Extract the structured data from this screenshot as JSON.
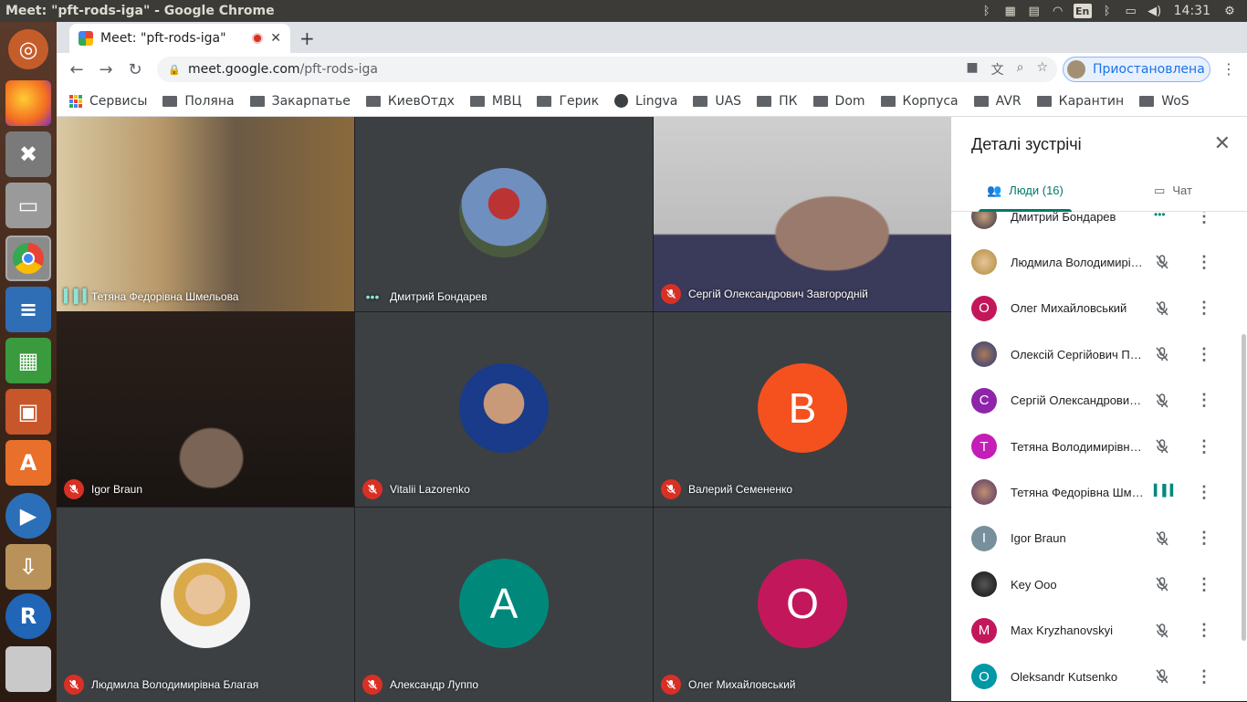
{
  "window": {
    "title": "Meet: \"pft-rods-iga\" - Google Chrome"
  },
  "topbar": {
    "lang": "En",
    "time": "14:31"
  },
  "tab": {
    "title": "Meet: \"pft-rods-iga\"",
    "close": "✕",
    "new": "+"
  },
  "omnibox": {
    "host": "meet.google.com",
    "path": "/pft-rods-iga"
  },
  "profile": {
    "label": "Приостановлена"
  },
  "bookmarks": [
    "Сервисы",
    "Поляна",
    "Закарпатье",
    "КиевОтдх",
    "МВЦ",
    "Герик",
    "Lingva",
    "UAS",
    "ПК",
    "Dom",
    "Корпуса",
    "AVR",
    "Карантин",
    "WoS"
  ],
  "tiles": [
    {
      "name": "Тетяна Федорівна Шмельова",
      "status": "speaking",
      "type": "video-woman"
    },
    {
      "name": "Дмитрий Бондарев",
      "status": "dots",
      "type": "photo"
    },
    {
      "name": "Сергій Олександрович Завгородній",
      "status": "muted",
      "type": "video-man"
    },
    {
      "name": "Igor Braun",
      "status": "muted",
      "type": "video-dark"
    },
    {
      "name": "Vitalii Lazorenko",
      "status": "muted",
      "type": "photo"
    },
    {
      "name": "Валерий Семененко",
      "status": "muted",
      "type": "letter",
      "letter": "В",
      "color": "#f4511e"
    },
    {
      "name": "Людмила Володимирівна Благая",
      "status": "muted",
      "type": "photo"
    },
    {
      "name": "Александр Луппо",
      "status": "muted",
      "type": "letter",
      "letter": "A",
      "color": "#00897b"
    },
    {
      "name": "Олег Михайловський",
      "status": "muted",
      "type": "letter",
      "letter": "O",
      "color": "#c2185b"
    }
  ],
  "panel": {
    "title": "Деталі зустрічі",
    "tab_people": "Люди (16)",
    "tab_chat": "Чат",
    "people": [
      {
        "name": "Дмитрий Бондарев",
        "avatar": "photo",
        "status": "dots"
      },
      {
        "name": "Людмила Володимирівна Благая",
        "avatar": "photo",
        "status": "muted"
      },
      {
        "name": "Олег Михайловський",
        "avatar": "О",
        "color": "#c2185b",
        "status": "muted"
      },
      {
        "name": "Олексій Сергійович Павленко",
        "avatar": "photo",
        "status": "muted"
      },
      {
        "name": "Сергій Олександрович Завгородній",
        "avatar": "С",
        "color": "#8e24aa",
        "status": "muted"
      },
      {
        "name": "Тетяна Володимирівна Коваленко",
        "avatar": "Т",
        "color": "#c51db8",
        "status": "muted"
      },
      {
        "name": "Тетяна Федорівна Шмельова",
        "avatar": "photo",
        "status": "speaking"
      },
      {
        "name": "Igor Braun",
        "avatar": "I",
        "color": "#78909c",
        "status": "muted"
      },
      {
        "name": "Key Ooo",
        "avatar": "photo",
        "status": "muted"
      },
      {
        "name": "Max Kryzhanovskyi",
        "avatar": "M",
        "color": "#c2185b",
        "status": "muted"
      },
      {
        "name": "Oleksandr Kutsenko",
        "avatar": "O",
        "color": "#0097a7",
        "status": "muted"
      }
    ]
  }
}
